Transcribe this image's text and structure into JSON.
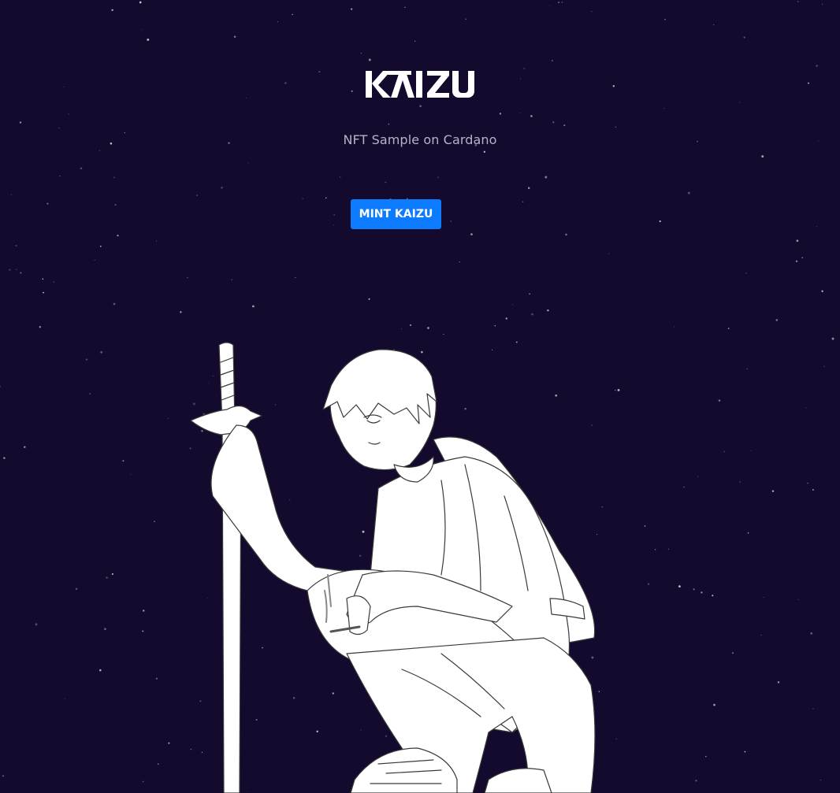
{
  "header": {
    "logo_text": "KAIZU",
    "subtitle": "NFT Sample on Cardano"
  },
  "actions": {
    "mint_label": "MINT KAIZU"
  },
  "colors": {
    "background": "#140a2e",
    "accent": "#0d7bff",
    "subtitle": "#b7b3c6",
    "logo": "#ffffff"
  },
  "icons": {
    "hero": "kneeling-swordsman-illustration"
  }
}
